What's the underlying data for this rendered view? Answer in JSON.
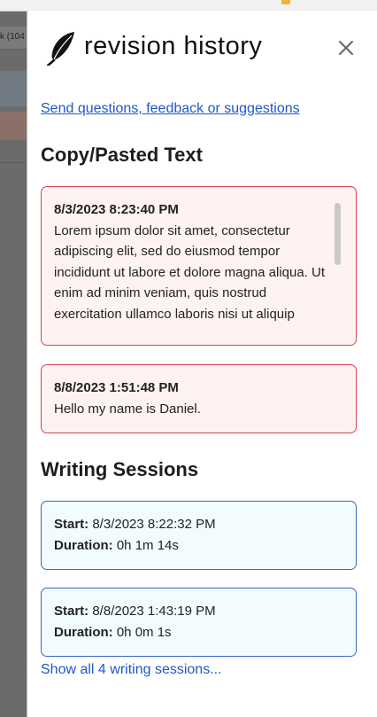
{
  "background": {
    "row_text": "k (104"
  },
  "header": {
    "title": "revision history"
  },
  "feedback_link": "Send questions, feedback or suggestions",
  "copy_section": {
    "heading": "Copy/Pasted Text",
    "items": [
      {
        "timestamp": "8/3/2023 8:23:40 PM",
        "text": "Lorem ipsum dolor sit amet, consectetur adipiscing elit, sed do eiusmod tempor incididunt ut labore et dolore magna aliqua. Ut enim ad minim veniam, quis nostrud exercitation ullamco laboris nisi ut aliquip"
      },
      {
        "timestamp": "8/8/2023 1:51:48 PM",
        "text": "Hello my name is Daniel."
      }
    ]
  },
  "sessions_section": {
    "heading": "Writing Sessions",
    "start_label": "Start:",
    "duration_label": "Duration:",
    "items": [
      {
        "start": "8/3/2023 8:22:32 PM",
        "duration": "0h 1m 14s"
      },
      {
        "start": "8/8/2023 1:43:19 PM",
        "duration": "0h 0m 1s"
      }
    ],
    "show_all": "Show all 4 writing sessions..."
  },
  "colors": {
    "link": "#1f57c9",
    "paste_border": "#d6454f",
    "session_border": "#3d65c4"
  }
}
